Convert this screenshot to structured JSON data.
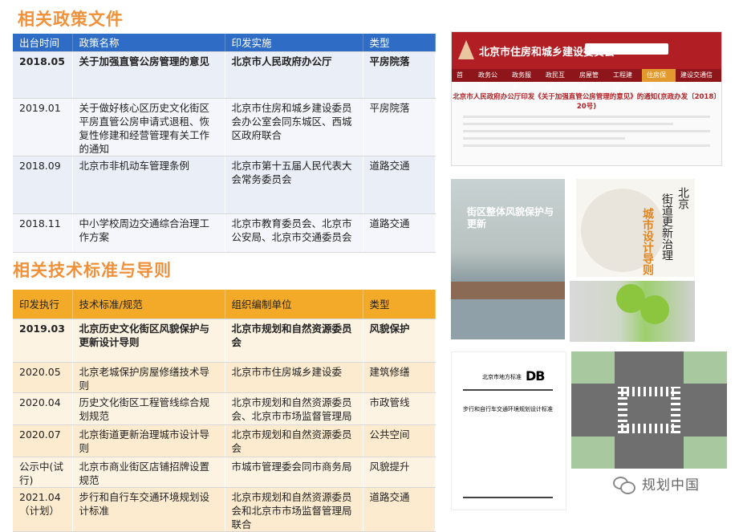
{
  "policy": {
    "title": "相关政策文件",
    "headers": [
      "出台时间",
      "政策名称",
      "印发实施",
      "类型"
    ],
    "rows": [
      [
        "2018.05",
        "关于加强直管公房管理的意见",
        "北京市人民政府办公厅",
        "平房院落"
      ],
      [
        "2019.01",
        "关于做好核心区历史文化街区平房直管公房申请式退租、恢复性修建和经营管理有关工作的通知",
        "北京市住房和城乡建设委员会办公室会同东城区、西城区政府联合",
        "平房院落"
      ],
      [
        "2018.09",
        "北京市非机动车管理条例",
        "北京市第十五届人民代表大会常务委员会",
        "道路交通"
      ],
      [
        "2018.11",
        "中小学校周边交通综合治理工作方案",
        "北京市教育委员会、北京市公安局、北京市交通委员会",
        "道路交通"
      ]
    ]
  },
  "standards": {
    "title": "相关技术标准与导则",
    "headers": [
      "印发执行",
      "技术标准/规范",
      "组织编制单位",
      "类型"
    ],
    "rows": [
      [
        "2019.03",
        "北京历史文化街区风貌保护与更新设计导则",
        "北京市规划和自然资源委员会",
        "风貌保护"
      ],
      [
        "2020.05",
        "北京老城保护房屋修缮技术导则",
        "北京市市住房城乡建设委",
        "建筑修缮"
      ],
      [
        "2020.04",
        "历史文化街区工程管线综合规划规范",
        "北京市规划和自然资源委员会、北京市市场监督管理局",
        "市政管线"
      ],
      [
        "2020.07",
        "北京街道更新治理城市设计导则",
        "北京市规划和自然资源委员会",
        "公共空间"
      ],
      [
        "公示中(试行)",
        "北京市商业街区店铺招牌设置规范",
        "市城市管理委会同市商务局",
        "风貌提升"
      ],
      [
        "2021.04（计划）",
        "步行和自行车交通环境规划设计标准",
        "北京市规划和自然资源委员会和北京市市场监督管理局联合",
        "道路交通"
      ]
    ]
  },
  "images": {
    "website": {
      "site_title": "北京市住房和城乡建设委员会",
      "nav": [
        "首页",
        "政务公开",
        "政务服务",
        "政民互动",
        "房屋管理",
        "工程建设",
        "住房保障",
        "建设交通信息"
      ],
      "article_title": "北京市人民政府办公厅印发《关于加强直管公房管理的意见》的通知(京政办发〔2018〕20号)"
    },
    "book1": {
      "title": "街区整体风貌保护与更新"
    },
    "book2": {
      "line1": "北京",
      "line2": "街道更新治理",
      "line3": "城市设计导则"
    },
    "standard_cover": {
      "db_label": "DB",
      "issuer": "北京市地方标准",
      "title": "步行和自行车交通环境规划设计标准"
    }
  },
  "watermark": {
    "text": "规划中国"
  },
  "colors": {
    "orange_title": "#f0913a",
    "blue_header": "#2f6cc6",
    "orange_header": "#f3aa28"
  }
}
